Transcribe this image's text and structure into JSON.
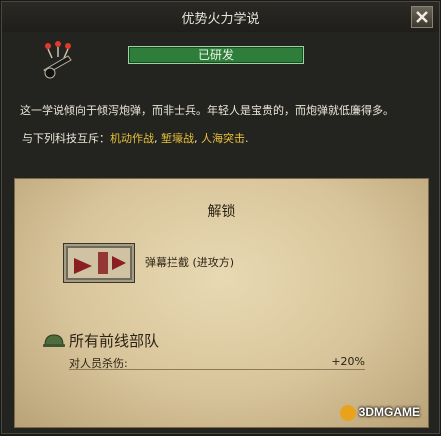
{
  "window": {
    "title": "优势火力学说"
  },
  "doctrine": {
    "status_label": "已研发",
    "description": "这一学说倾向于倾泻炮弹，而非士兵。年轻人是宝贵的，而炮弹就低廉得多。",
    "exclusive_prefix": "与下列科技互斥：",
    "exclusive_techs": [
      "机动作战",
      "堑壕战",
      "人海突击"
    ],
    "exclusive_separator": ", ",
    "exclusive_suffix": "."
  },
  "unlock": {
    "title": "解锁",
    "item_label": "弹幕拦截 (进攻方)"
  },
  "modifiers": {
    "group_title": "所有前线部队",
    "rows": [
      {
        "label": "对人员杀伤:",
        "value": "+20%"
      }
    ]
  },
  "watermark": {
    "text": "3DMGAME"
  },
  "colors": {
    "status_green": "#2e7d3b",
    "tech_yellow": "#e8c23a",
    "parchment": "#e8d9b3"
  },
  "icons": {
    "close": "close-icon",
    "doctrine": "artillery-doctrine-icon",
    "unlock": "barrage-tactic-icon",
    "army": "helmet-icon"
  }
}
